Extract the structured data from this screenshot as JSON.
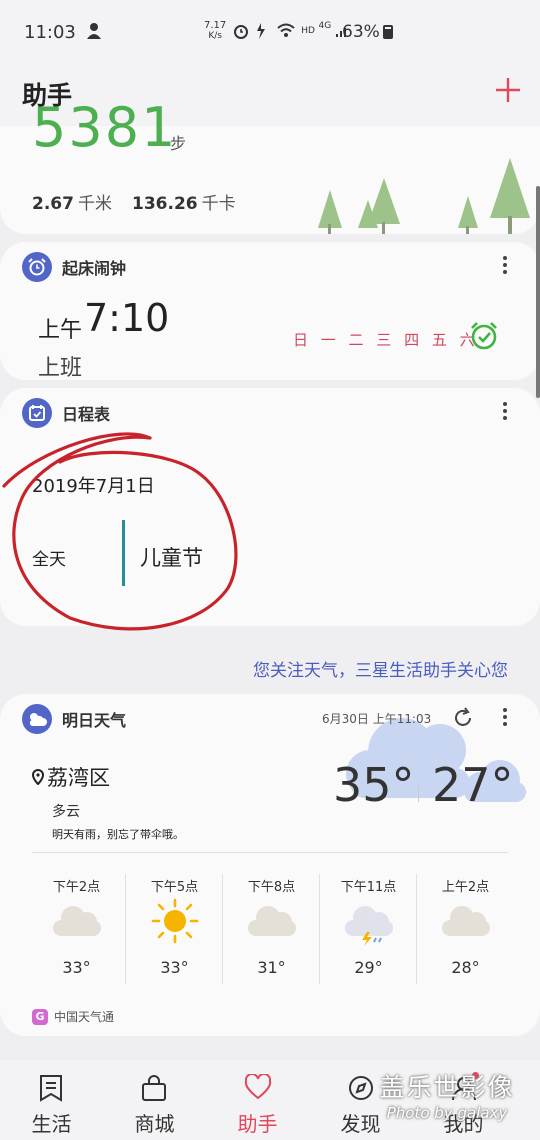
{
  "status_bar": {
    "time": "11:03",
    "net_speed_value": "7.17",
    "net_speed_unit": "K/s",
    "hd_label": "HD",
    "network": "4G",
    "battery": "63%"
  },
  "header": {
    "title": "助手"
  },
  "steps_card": {
    "steps": "5381",
    "steps_unit": "步",
    "distance": "2.67",
    "distance_unit": "千米",
    "calories": "136.26",
    "calories_unit": "千卡"
  },
  "alarm_card": {
    "title": "起床闹钟",
    "ampm": "上午",
    "time": "7:10",
    "label": "上班",
    "days": "日 一 二 三 四 五 六"
  },
  "schedule_card": {
    "title": "日程表",
    "date": "2019年7月1日",
    "all_day": "全天",
    "event": "儿童节"
  },
  "tip": "您关注天气，三星生活助手关心您",
  "weather_card": {
    "title": "明日天气",
    "updated": "6月30日 上午11:03",
    "location": "荔湾区",
    "condition": "多云",
    "advice": "明天有雨，别忘了带伞哦。",
    "high": "35°",
    "low": "27°",
    "hourly": [
      {
        "time": "下午2点",
        "icon": "cloudy-icon",
        "temp": "33°"
      },
      {
        "time": "下午5点",
        "icon": "sun-icon",
        "temp": "33°"
      },
      {
        "time": "下午8点",
        "icon": "cloudy-icon",
        "temp": "31°"
      },
      {
        "time": "下午11点",
        "icon": "thunderstorm-icon",
        "temp": "29°"
      },
      {
        "time": "上午2点",
        "icon": "cloudy-icon",
        "temp": "28°"
      }
    ],
    "source": "中国天气通"
  },
  "tabs": [
    {
      "label": "生活",
      "icon": "bookmark-icon"
    },
    {
      "label": "商城",
      "icon": "shopping-bag-icon"
    },
    {
      "label": "助手",
      "icon": "heart-icon",
      "active": true
    },
    {
      "label": "发现",
      "icon": "discover-icon"
    },
    {
      "label": "我的",
      "icon": "profile-icon"
    }
  ],
  "watermark": {
    "line1": "盖乐世影像",
    "line2": "Photo by galaxy"
  },
  "colors": {
    "accent": "#e0485d",
    "card_icon": "#5266c9",
    "steps": "#4caf50",
    "alarm_days": "#d0485c",
    "tip": "#4a5cc0"
  }
}
